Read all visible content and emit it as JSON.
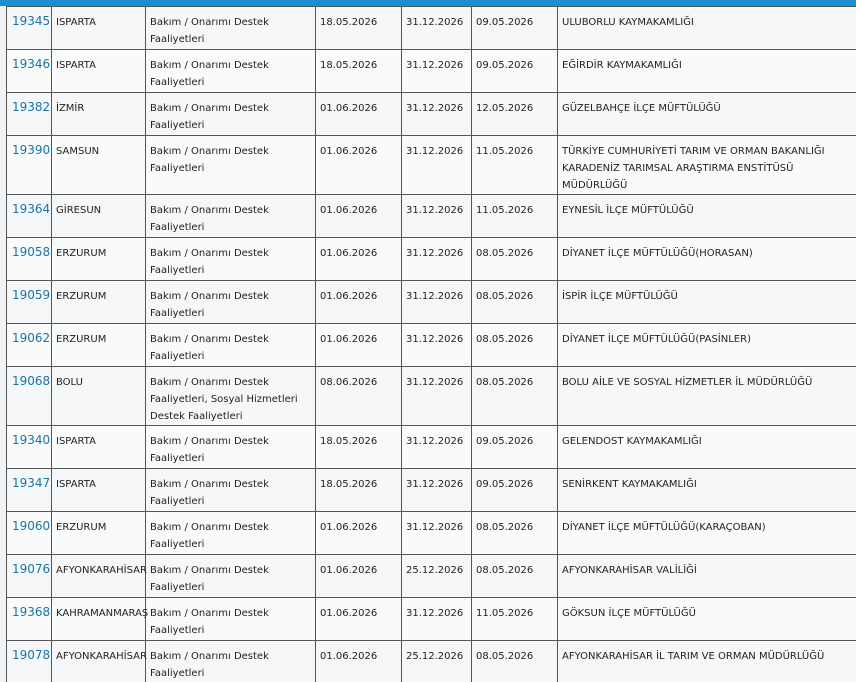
{
  "rows": [
    {
      "id": "19345",
      "city": "ISPARTA",
      "activity": "Bakım / Onarımı Destek Faaliyetleri",
      "start": "18.05.2026",
      "end": "31.12.2026",
      "date3": "09.05.2026",
      "org": "ULUBORLU KAYMAKAMLIĞI",
      "h": "h2"
    },
    {
      "id": "19346",
      "city": "ISPARTA",
      "activity": "Bakım / Onarımı Destek Faaliyetleri",
      "start": "18.05.2026",
      "end": "31.12.2026",
      "date3": "09.05.2026",
      "org": "EĞİRDİR KAYMAKAMLIĞI",
      "h": "h2"
    },
    {
      "id": "19382",
      "city": "İZMİR",
      "activity": "Bakım / Onarımı Destek Faaliyetleri",
      "start": "01.06.2026",
      "end": "31.12.2026",
      "date3": "12.05.2026",
      "org": "GÜZELBAHÇE İLÇE MÜFTÜLÜĞÜ",
      "h": "h2"
    },
    {
      "id": "19390",
      "city": "SAMSUN",
      "activity": "Bakım / Onarımı Destek Faaliyetleri",
      "start": "01.06.2026",
      "end": "31.12.2026",
      "date3": "11.05.2026",
      "org": "TÜRKİYE CUMHURİYETİ TARIM VE ORMAN BAKANLIĞI KARADENİZ TARIMSAL ARAŞTIRMA ENSTİTÜSÜ MÜDÜRLÜĞÜ",
      "h": "h3"
    },
    {
      "id": "19364",
      "city": "GİRESUN",
      "activity": "Bakım / Onarımı Destek Faaliyetleri",
      "start": "01.06.2026",
      "end": "31.12.2026",
      "date3": "11.05.2026",
      "org": "EYNESİL İLÇE MÜFTÜLÜĞÜ",
      "h": "h2"
    },
    {
      "id": "19058",
      "city": "ERZURUM",
      "activity": "Bakım / Onarımı Destek Faaliyetleri",
      "start": "01.06.2026",
      "end": "31.12.2026",
      "date3": "08.05.2026",
      "org": "DİYANET İLÇE MÜFTÜLÜĞÜ(HORASAN)",
      "h": "h2"
    },
    {
      "id": "19059",
      "city": "ERZURUM",
      "activity": "Bakım / Onarımı Destek Faaliyetleri",
      "start": "01.06.2026",
      "end": "31.12.2026",
      "date3": "08.05.2026",
      "org": "İSPİR İLÇE MÜFTÜLÜĞÜ",
      "h": "h2"
    },
    {
      "id": "19062",
      "city": "ERZURUM",
      "activity": "Bakım / Onarımı Destek Faaliyetleri",
      "start": "01.06.2026",
      "end": "31.12.2026",
      "date3": "08.05.2026",
      "org": "DİYANET İLÇE MÜFTÜLÜĞÜ(PASİNLER)",
      "h": "h2"
    },
    {
      "id": "19068",
      "city": "BOLU",
      "activity": "Bakım / Onarımı Destek Faaliyetleri, Sosyal Hizmetleri Destek Faaliyetleri",
      "start": "08.06.2026",
      "end": "31.12.2026",
      "date3": "08.05.2026",
      "org": "BOLU AİLE VE SOSYAL HİZMETLER İL MÜDÜRLÜĞÜ",
      "h": "h3"
    },
    {
      "id": "19340",
      "city": "ISPARTA",
      "activity": "Bakım / Onarımı Destek Faaliyetleri",
      "start": "18.05.2026",
      "end": "31.12.2026",
      "date3": "09.05.2026",
      "org": "GELENDOST KAYMAKAMLIĞI",
      "h": "h2"
    },
    {
      "id": "19347",
      "city": "ISPARTA",
      "activity": "Bakım / Onarımı Destek Faaliyetleri",
      "start": "18.05.2026",
      "end": "31.12.2026",
      "date3": "09.05.2026",
      "org": "SENİRKENT KAYMAKAMLIĞI",
      "h": "h2"
    },
    {
      "id": "19060",
      "city": "ERZURUM",
      "activity": "Bakım / Onarımı Destek Faaliyetleri",
      "start": "01.06.2026",
      "end": "31.12.2026",
      "date3": "08.05.2026",
      "org": "DİYANET İLÇE MÜFTÜLÜĞÜ(KARAÇOBAN)",
      "h": "h2"
    },
    {
      "id": "19076",
      "city": "AFYONKARAHİSAR",
      "activity": "Bakım / Onarımı Destek Faaliyetleri",
      "start": "01.06.2026",
      "end": "25.12.2026",
      "date3": "08.05.2026",
      "org": "AFYONKARAHİSAR VALİLİĞİ",
      "h": "h2"
    },
    {
      "id": "19368",
      "city": "KAHRAMANMARAŞ",
      "activity": "Bakım / Onarımı Destek Faaliyetleri",
      "start": "01.06.2026",
      "end": "31.12.2026",
      "date3": "11.05.2026",
      "org": "GÖKSUN İLÇE MÜFTÜLÜĞÜ",
      "h": "h2"
    },
    {
      "id": "19078",
      "city": "AFYONKARAHİSAR",
      "activity": "Bakım / Onarımı Destek Faaliyetleri",
      "start": "01.06.2026",
      "end": "25.12.2026",
      "date3": "08.05.2026",
      "org": "AFYONKARAHİSAR İL TARIM VE ORMAN MÜDÜRLÜĞÜ",
      "h": "h2"
    }
  ]
}
